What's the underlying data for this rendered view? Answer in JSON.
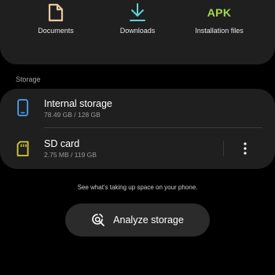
{
  "categories": [
    {
      "label": "Documents",
      "icon": "document-icon",
      "color": "#e8c9a0"
    },
    {
      "label": "Downloads",
      "icon": "download-icon",
      "color": "#5ed3d8"
    },
    {
      "label": "Installation files",
      "icon": "apk-icon",
      "icon_text": "APK",
      "color": "#a6d94a"
    }
  ],
  "storage": {
    "header": "Storage",
    "items": [
      {
        "title": "Internal storage",
        "subtitle": "78.49 GB / 128 GB",
        "icon": "phone-icon",
        "color": "#4aa3f2"
      },
      {
        "title": "SD card",
        "subtitle": "2.75 MB / 119 GB",
        "icon": "sd-card-icon",
        "color": "#d4cc3c"
      }
    ],
    "more_icon": "more-vert-icon"
  },
  "hint": "See what's taking up space on your phone.",
  "analyze_button": {
    "label": "Analyze storage",
    "icon": "analyze-storage-icon"
  },
  "colors": {
    "background": "#000000",
    "card": "#1f1f1f",
    "button": "#2b2b2b"
  }
}
